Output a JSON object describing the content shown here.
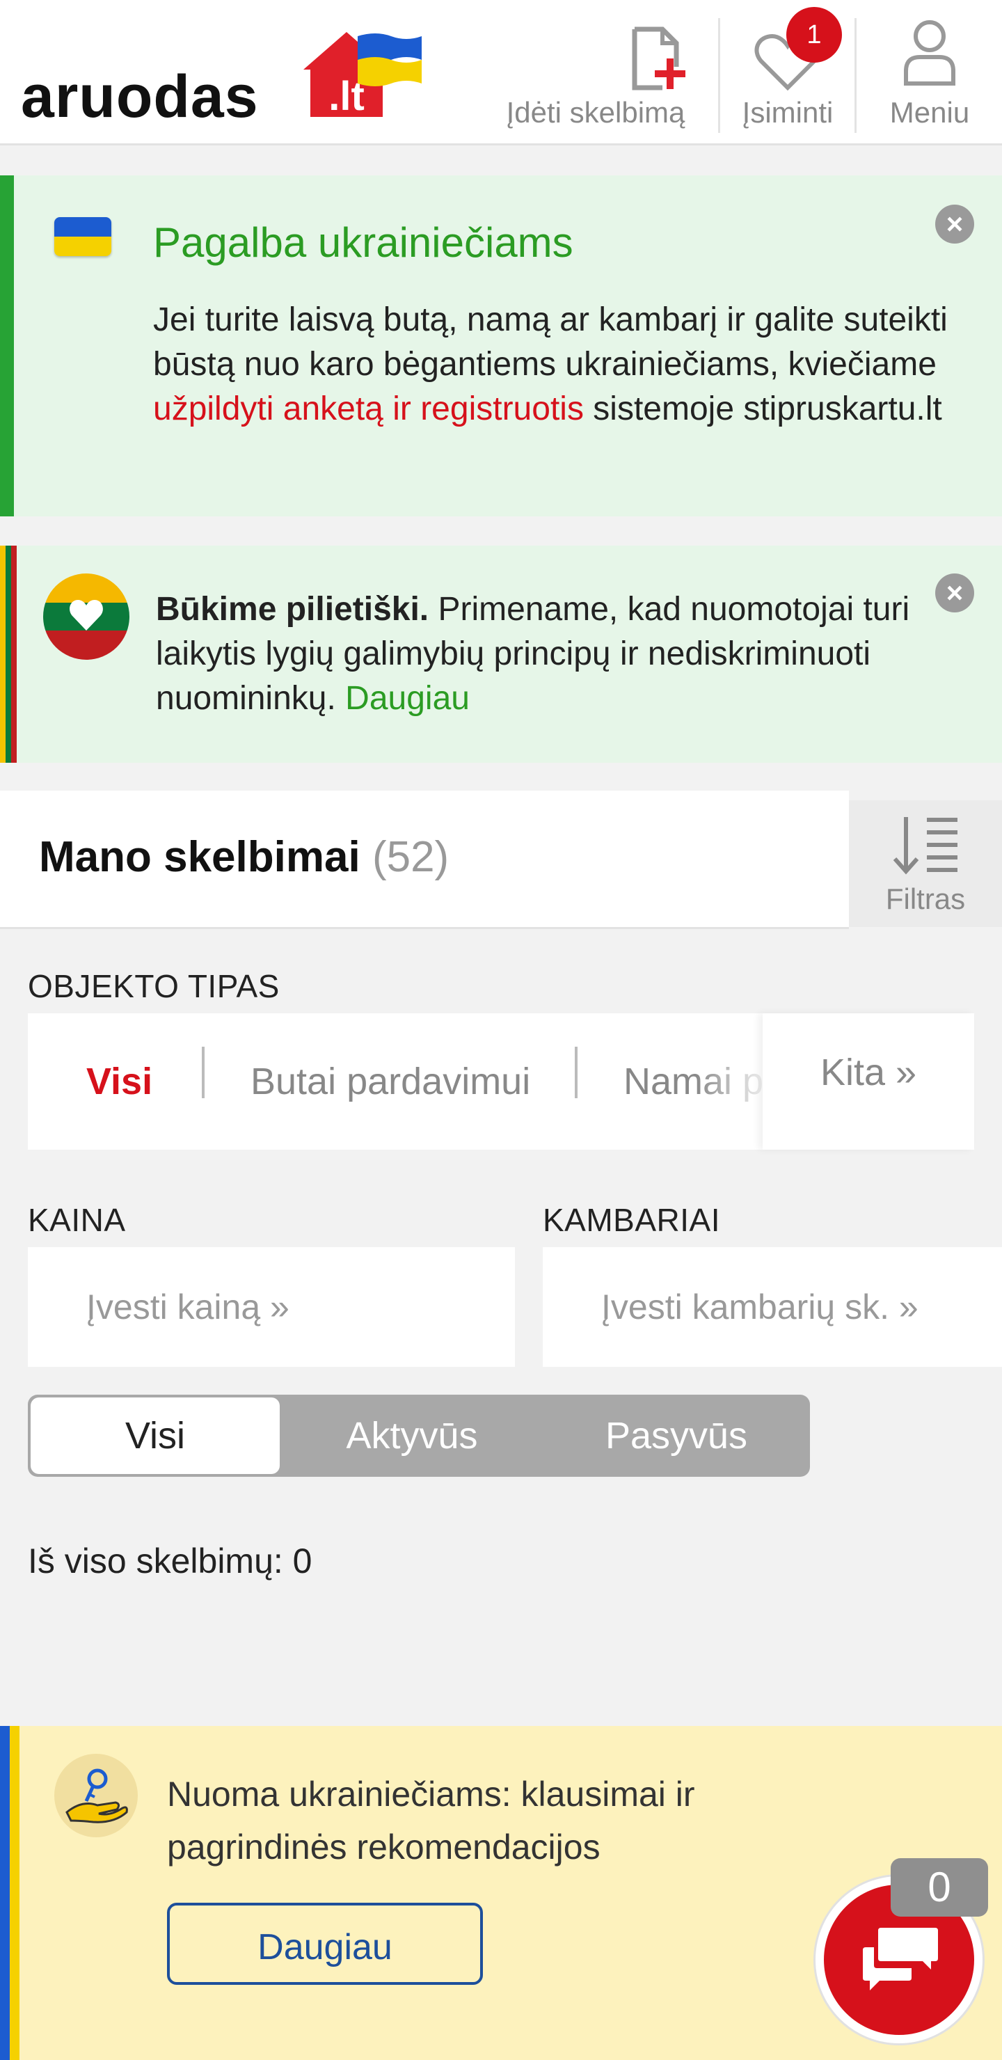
{
  "header": {
    "logo_text": "aruodas",
    "logo_suffix": ".lt",
    "nav": {
      "add_label": "Įdėti skelbimą",
      "saved_label": "Įsiminti",
      "saved_badge": "1",
      "menu_label": "Meniu"
    }
  },
  "notice_ukraine": {
    "title": "Pagalba ukrainiečiams",
    "body_before": "Jei turite laisvą butą, namą ar kambarį ir galite suteikti būstą nuo karo bėgantiems ukrainiečiams, kviečiame ",
    "link": "užpildyti anketą ir registruotis",
    "body_after": " sistemoje stipruskartu.lt"
  },
  "notice_civic": {
    "bold": "Būkime pilietiški.",
    "body": " Primename, kad nuomotojai turi laikytis lygių galimybių principų ir nediskriminuoti nuomininkų. ",
    "link": "Daugiau"
  },
  "listings": {
    "title": "Mano skelbimai",
    "count": "(52)",
    "filter_label": "Filtras"
  },
  "object_type": {
    "label": "OBJEKTO TIPAS",
    "items": [
      "Visi",
      "Butai pardavimui",
      "Namai p"
    ],
    "more": "Kita »",
    "active_color": "#d6111b"
  },
  "price": {
    "label": "KAINA",
    "placeholder": "Įvesti kainą »"
  },
  "rooms": {
    "label": "KAMBARIAI",
    "placeholder": "Įvesti kambarių sk. »"
  },
  "status_tabs": {
    "items": [
      "Visi",
      "Aktyvūs",
      "Pasyvūs"
    ],
    "active": "Visi"
  },
  "total": "Iš viso skelbimų: 0",
  "banner": {
    "text": "Nuoma ukrainiečiams: klausimai ir pagrindinės rekomendacijos",
    "button": "Daugiau"
  },
  "chat": {
    "count": "0",
    "icon": "chat-bubbles-icon"
  },
  "colors": {
    "brand_red": "#d6111b",
    "green": "#2b9c23",
    "ukraine_blue": "#1c5cd0",
    "ukraine_yellow": "#f5d100"
  }
}
